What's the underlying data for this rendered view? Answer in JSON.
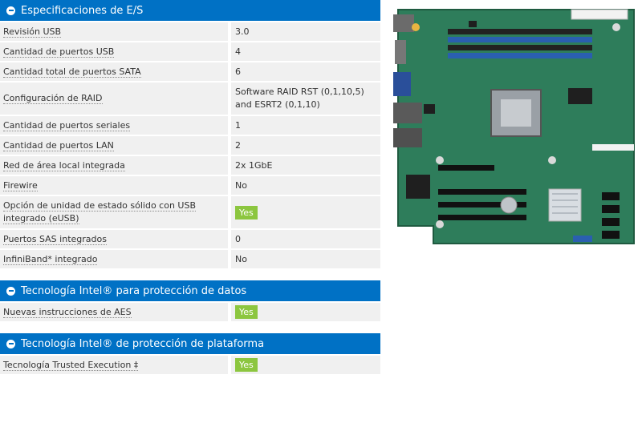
{
  "sections": [
    {
      "title": "Especificaciones de E/S",
      "rows": [
        {
          "label": "Revisión USB",
          "value": "3.0"
        },
        {
          "label": "Cantidad de puertos USB",
          "value": "4"
        },
        {
          "label": "Cantidad total de puertos SATA",
          "value": "6"
        },
        {
          "label": "Configuración de RAID",
          "value": "Software RAID RST (0,1,10,5) and ESRT2 (0,1,10)"
        },
        {
          "label": "Cantidad de puertos seriales",
          "value": "1"
        },
        {
          "label": "Cantidad de puertos LAN",
          "value": "2"
        },
        {
          "label": "Red de área local integrada",
          "value": "2x 1GbE"
        },
        {
          "label": "Firewire",
          "value": "No"
        },
        {
          "label": "Opción de unidad de estado sólido con USB integrado (eUSB)",
          "value": "Yes"
        },
        {
          "label": "Puertos SAS integrados",
          "value": "0"
        },
        {
          "label": "InfiniBand* integrado",
          "value": "No"
        }
      ]
    },
    {
      "title": "Tecnología Intel® para protección de datos",
      "rows": [
        {
          "label": "Nuevas instrucciones de AES",
          "value": "Yes"
        }
      ]
    },
    {
      "title": "Tecnología Intel® de protección de plataforma",
      "rows": [
        {
          "label": "Tecnología Trusted Execution ‡",
          "value": "Yes"
        }
      ]
    }
  ],
  "colors": {
    "header_bg": "#0071c5",
    "row_bg": "#f0f0f0",
    "yes_badge": "#8cc63f",
    "board_pcb": "#2e7d5b"
  },
  "icons": {
    "section_toggle": "collapse-minus-icon"
  },
  "image": {
    "subject": "server-motherboard"
  }
}
